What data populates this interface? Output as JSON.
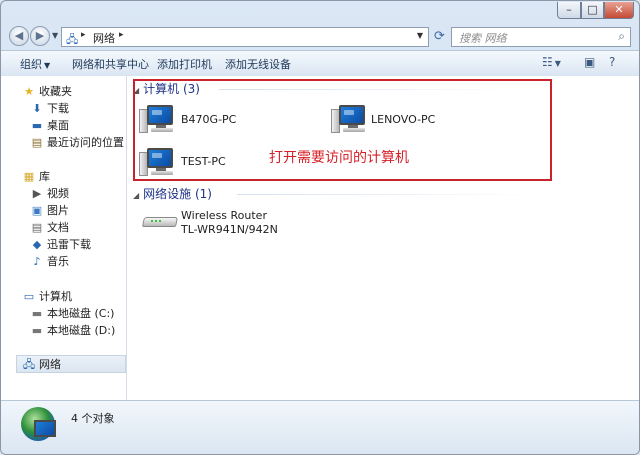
{
  "titlebar": {
    "minimize": "–",
    "maximize": "□",
    "close": "✕"
  },
  "address": {
    "path": "网络",
    "separator": "▸"
  },
  "search": {
    "placeholder": "搜索 网络"
  },
  "toolbar": {
    "organize": "组织",
    "network_sharing": "网络和共享中心",
    "add_printer": "添加打印机",
    "add_wireless": "添加无线设备"
  },
  "sidebar": {
    "favorites": {
      "label": "收藏夹",
      "items": [
        {
          "label": "下载"
        },
        {
          "label": "桌面"
        },
        {
          "label": "最近访问的位置"
        }
      ]
    },
    "libraries": {
      "label": "库",
      "items": [
        {
          "label": "视频"
        },
        {
          "label": "图片"
        },
        {
          "label": "文档"
        },
        {
          "label": "迅雷下载"
        },
        {
          "label": "音乐"
        }
      ]
    },
    "computer": {
      "label": "计算机",
      "items": [
        {
          "label": "本地磁盘 (C:)"
        },
        {
          "label": "本地磁盘 (D:)"
        }
      ]
    },
    "network": {
      "label": "网络"
    }
  },
  "groups": {
    "computers": {
      "header": "计算机 (3)",
      "items": [
        {
          "name": "B470G-PC"
        },
        {
          "name": "LENOVO-PC"
        },
        {
          "name": "TEST-PC"
        }
      ]
    },
    "infrastructure": {
      "header": "网络设施 (1)",
      "items": [
        {
          "name": "Wireless Router",
          "model": "TL-WR941N/942N"
        }
      ]
    }
  },
  "annotation": "打开需要访问的计算机",
  "details": {
    "count": "4 个对象"
  },
  "colors": {
    "annotation": "#d61f26",
    "group_header": "#1e3287",
    "accent": "#1e7fd8"
  }
}
